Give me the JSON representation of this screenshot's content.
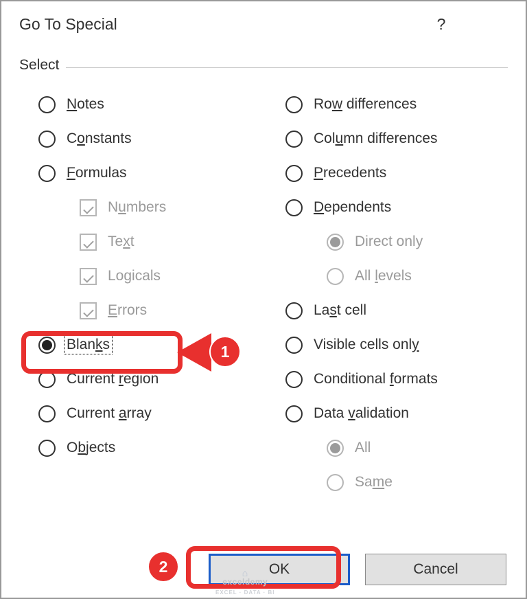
{
  "dialog": {
    "title": "Go To Special",
    "group_label": "Select",
    "ok_label": "OK",
    "cancel_label": "Cancel"
  },
  "left_column": [
    {
      "type": "radio",
      "label": "Notes",
      "ul": 0,
      "checked": false
    },
    {
      "type": "radio",
      "label": "Constants",
      "ul": 1,
      "checked": false
    },
    {
      "type": "radio",
      "label": "Formulas",
      "ul": 0,
      "checked": false
    },
    {
      "type": "checkbox",
      "label": "Numbers",
      "ul": 1,
      "checked": true,
      "disabled": true,
      "indent": 1
    },
    {
      "type": "checkbox",
      "label": "Text",
      "ul": 2,
      "checked": true,
      "disabled": true,
      "indent": 1
    },
    {
      "type": "checkbox",
      "label": "Logicals",
      "ul": 2,
      "checked": true,
      "disabled": true,
      "indent": 1
    },
    {
      "type": "checkbox",
      "label": "Errors",
      "ul": 0,
      "checked": true,
      "disabled": true,
      "indent": 1
    },
    {
      "type": "radio",
      "label": "Blanks",
      "ul": 4,
      "checked": true,
      "focus": true
    },
    {
      "type": "radio",
      "label": "Current region",
      "ul": 8,
      "checked": false
    },
    {
      "type": "radio",
      "label": "Current array",
      "ul": 8,
      "checked": false
    },
    {
      "type": "radio",
      "label": "Objects",
      "ul": 1,
      "checked": false
    }
  ],
  "right_column": [
    {
      "type": "radio",
      "label": "Row differences",
      "ul": 2,
      "checked": false
    },
    {
      "type": "radio",
      "label": "Column differences",
      "ul": 3,
      "checked": false
    },
    {
      "type": "radio",
      "label": "Precedents",
      "ul": 0,
      "checked": false
    },
    {
      "type": "radio",
      "label": "Dependents",
      "ul": 0,
      "checked": false
    },
    {
      "type": "radio",
      "label": "Direct only",
      "ul": -1,
      "checked": true,
      "disabled": true,
      "indent": 1
    },
    {
      "type": "radio",
      "label": "All levels",
      "ul": 4,
      "checked": false,
      "disabled": true,
      "indent": 1
    },
    {
      "type": "radio",
      "label": "Last cell",
      "ul": 2,
      "checked": false
    },
    {
      "type": "radio",
      "label": "Visible cells only",
      "ul": 17,
      "checked": false
    },
    {
      "type": "radio",
      "label": "Conditional formats",
      "ul": 12,
      "checked": false
    },
    {
      "type": "radio",
      "label": "Data validation",
      "ul": 5,
      "checked": false
    },
    {
      "type": "radio",
      "label": "All",
      "ul": -1,
      "checked": true,
      "disabled": true,
      "indent": 1
    },
    {
      "type": "radio",
      "label": "Same",
      "ul": 2,
      "checked": false,
      "disabled": true,
      "indent": 1
    }
  ],
  "callouts": {
    "one": "1",
    "two": "2"
  },
  "watermark": {
    "main": "exceldemy",
    "sub": "EXCEL · DATA · BI"
  }
}
